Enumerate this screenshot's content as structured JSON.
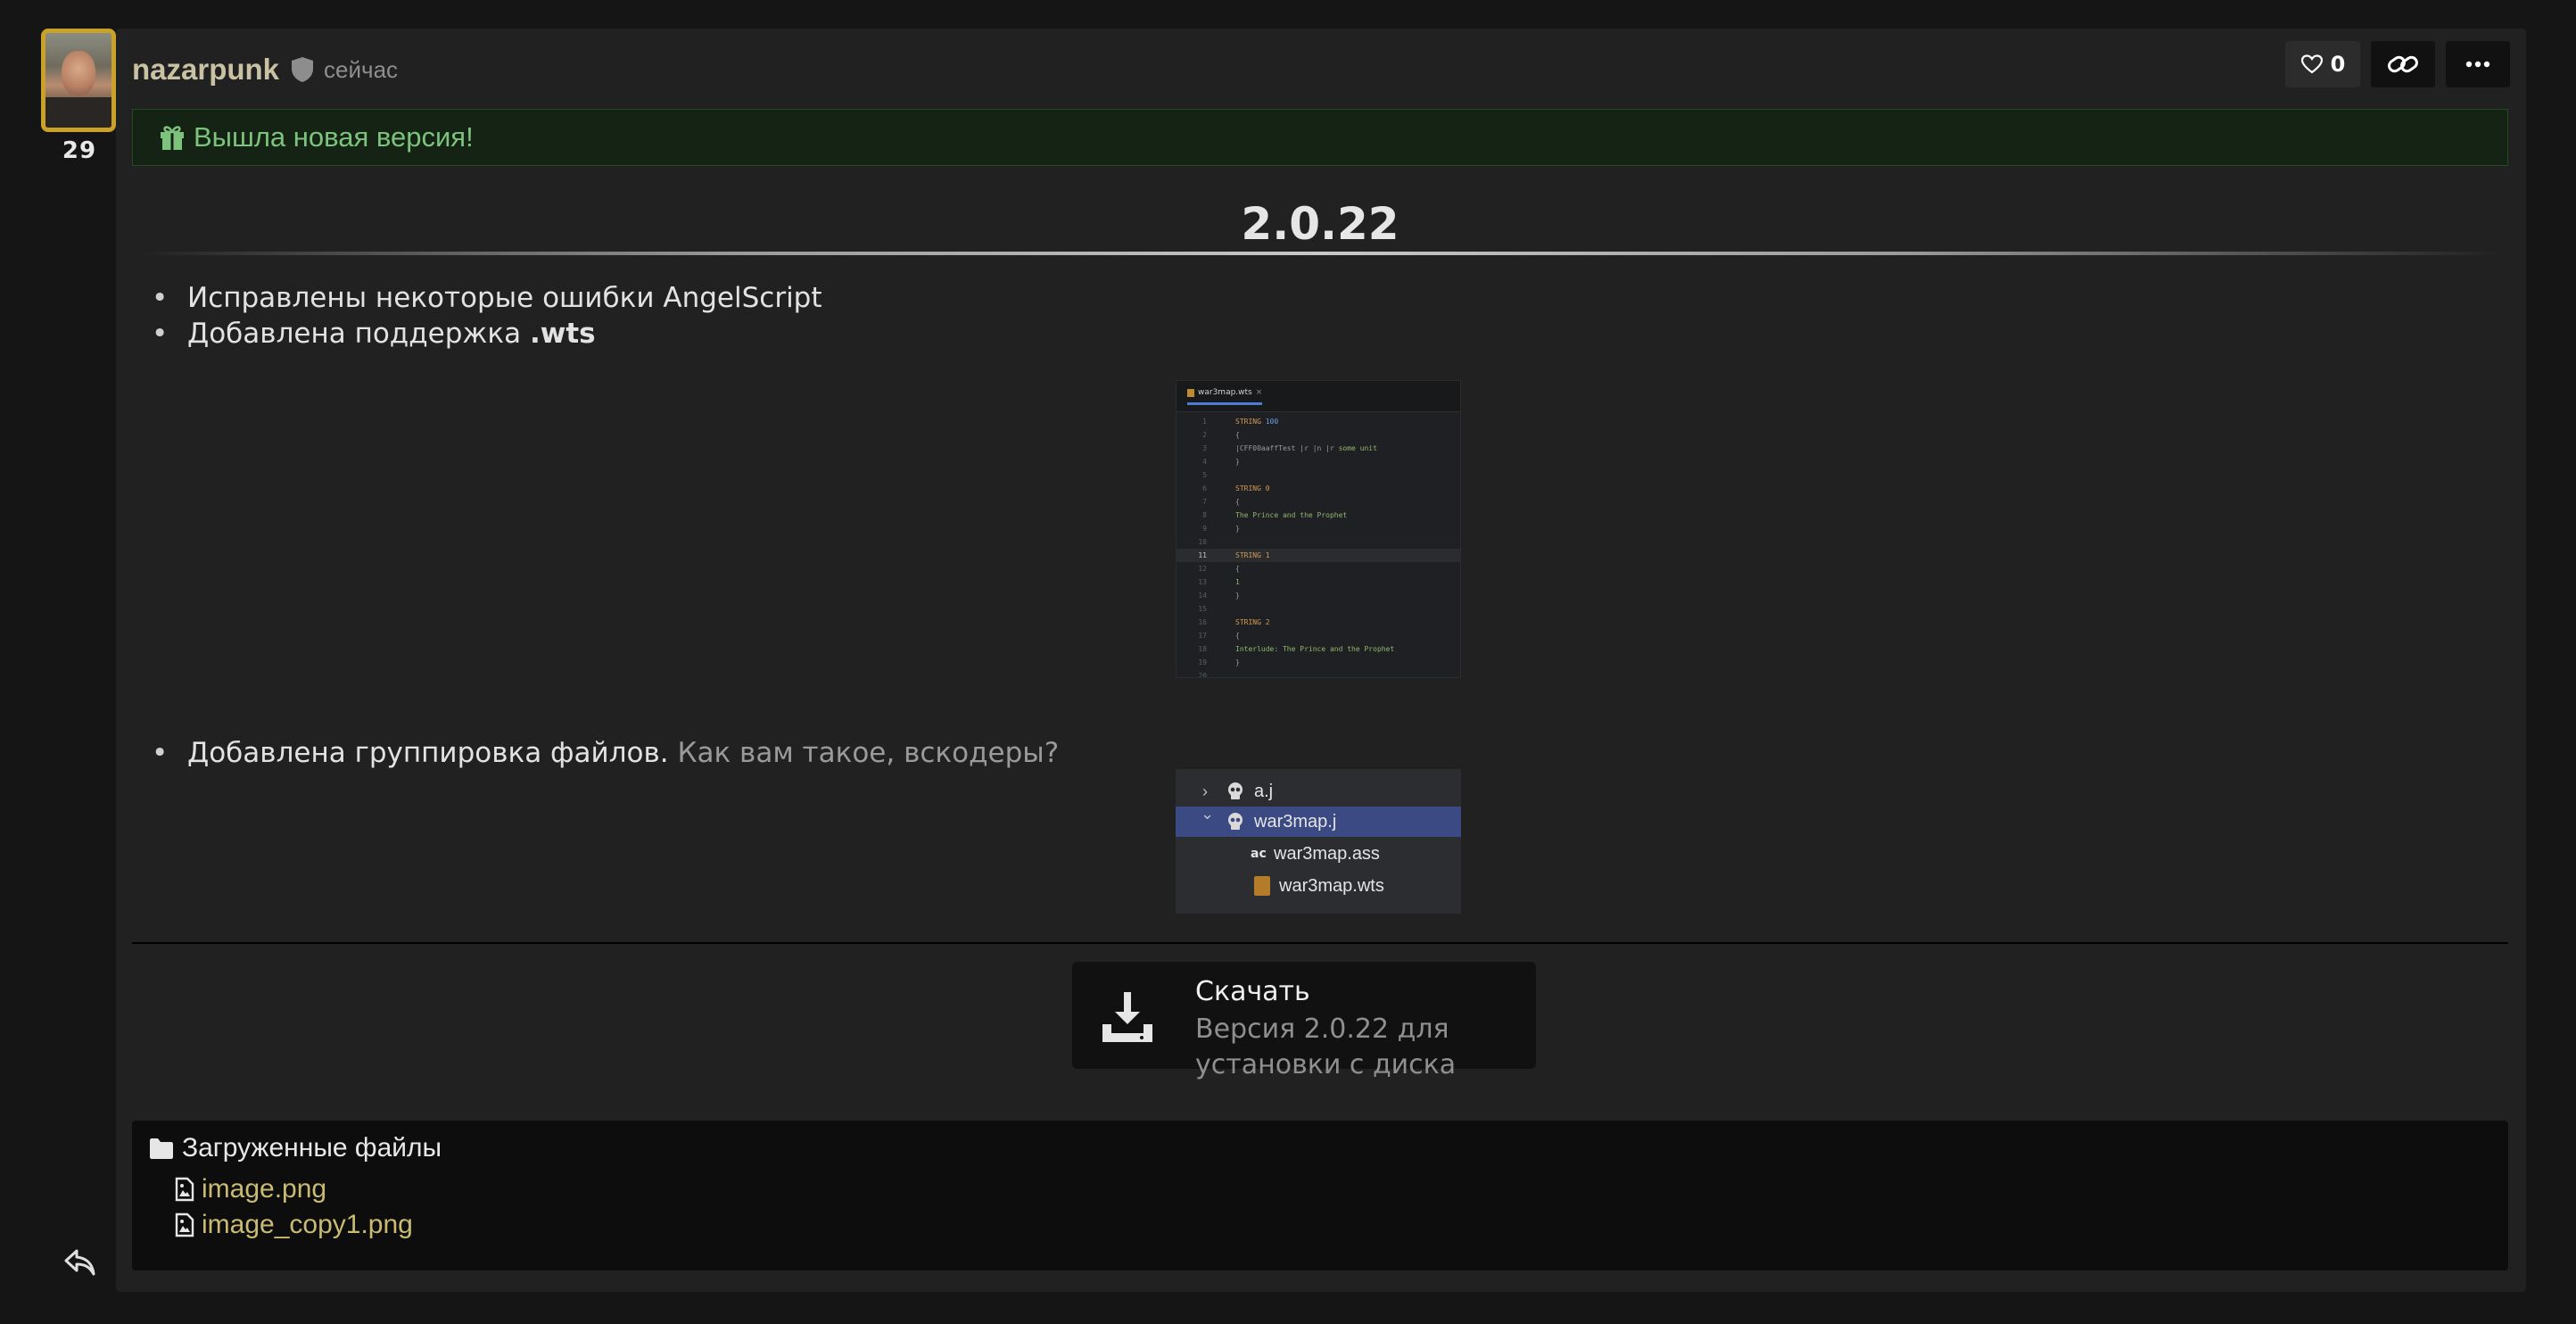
{
  "author": {
    "name": "nazarpunk",
    "level": "29",
    "timestamp": "сейчас"
  },
  "actions": {
    "like_count": "0",
    "like_icon": "heart-icon",
    "link_icon": "link-icon",
    "more_icon": "more-icon"
  },
  "announcement": {
    "icon": "gift-icon",
    "text": "Вышла новая версия!"
  },
  "release": {
    "version": "2.0.22",
    "changes_1": [
      {
        "text": "Исправлены некоторые ошибки AngelScript"
      },
      {
        "text": "Добавлена поддержка ",
        "strong": ".wts"
      }
    ],
    "changes_2": [
      {
        "text": "Добавлена группировка файлов. ",
        "muted": "Как вам такое, вскодеры?"
      }
    ]
  },
  "editor_screenshot": {
    "tab_label": "war3map.wts",
    "lines": [
      {
        "n": "1",
        "parts": [
          [
            "kw",
            "STRING "
          ],
          [
            "num",
            "100"
          ]
        ]
      },
      {
        "n": "2",
        "parts": [
          [
            "pun",
            "{"
          ]
        ]
      },
      {
        "n": "3",
        "parts": [
          [
            "pun",
            "|CFF00aaffTest |r |n |r "
          ],
          [
            "str",
            "some unit"
          ]
        ]
      },
      {
        "n": "4",
        "parts": [
          [
            "pun",
            "}"
          ]
        ]
      },
      {
        "n": "5",
        "parts": []
      },
      {
        "n": "6",
        "parts": [
          [
            "kw",
            "STRING 0"
          ]
        ]
      },
      {
        "n": "7",
        "parts": [
          [
            "pun",
            "{"
          ]
        ]
      },
      {
        "n": "8",
        "parts": [
          [
            "str",
            "The Prince and the Prophet"
          ]
        ]
      },
      {
        "n": "9",
        "parts": [
          [
            "pun",
            "}"
          ]
        ]
      },
      {
        "n": "10",
        "parts": []
      },
      {
        "n": "11",
        "parts": [
          [
            "kw",
            "STRING 1"
          ]
        ],
        "current": true
      },
      {
        "n": "12",
        "parts": [
          [
            "pun",
            "{"
          ]
        ]
      },
      {
        "n": "13",
        "parts": [
          [
            "str",
            "1"
          ]
        ]
      },
      {
        "n": "14",
        "parts": [
          [
            "pun",
            "}"
          ]
        ]
      },
      {
        "n": "15",
        "parts": []
      },
      {
        "n": "16",
        "parts": [
          [
            "kw",
            "STRING 2"
          ]
        ]
      },
      {
        "n": "17",
        "parts": [
          [
            "pun",
            "{"
          ]
        ]
      },
      {
        "n": "18",
        "parts": [
          [
            "str",
            "Interlude: The Prince and the Prophet"
          ]
        ]
      },
      {
        "n": "19",
        "parts": [
          [
            "pun",
            "}"
          ]
        ]
      },
      {
        "n": "20",
        "parts": []
      }
    ]
  },
  "tree_screenshot": {
    "items": [
      {
        "label": "a.j",
        "icon": "skull-icon",
        "chevron": "›",
        "selected": false
      },
      {
        "label": "war3map.j",
        "icon": "skull-icon",
        "chevron": "⌄",
        "selected": true
      },
      {
        "label": "war3map.ass",
        "icon": "ac",
        "chevron": "",
        "selected": false
      },
      {
        "label": "war3map.wts",
        "icon": "wts-icon",
        "chevron": "",
        "selected": false
      }
    ]
  },
  "download": {
    "icon": "download-icon",
    "title": "Скачать",
    "subtitle": "Версия 2.0.22 для установки с диска"
  },
  "uploaded_files": {
    "title": "Загруженные файлы",
    "items": [
      {
        "name": "image.png"
      },
      {
        "name": "image_copy1.png"
      }
    ]
  },
  "colors": {
    "background": "#151515",
    "post_bg": "#212121",
    "username": "#c9c1a4",
    "announce_text": "#7dc27d",
    "file_link": "#c9bb72",
    "avatar_border": "#c9a227"
  }
}
